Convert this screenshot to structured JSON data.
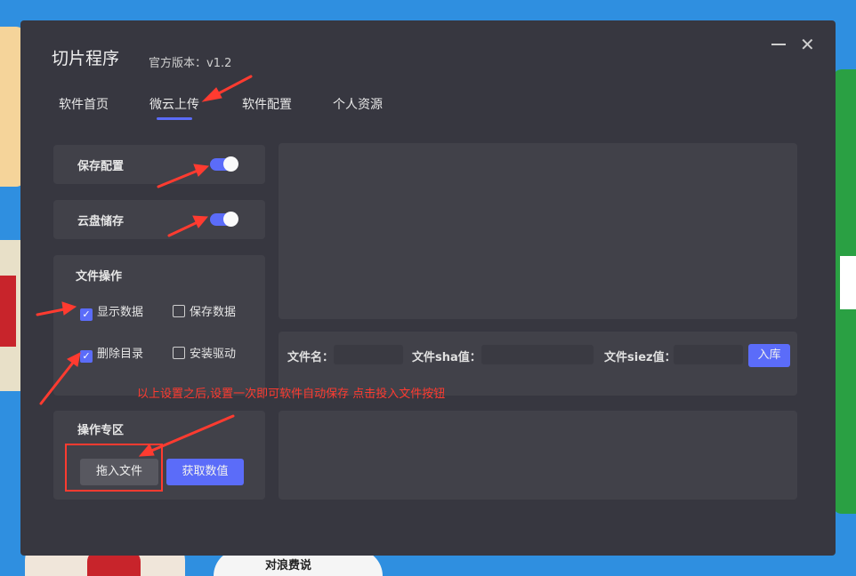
{
  "background": {
    "caption": "对浪费说"
  },
  "window": {
    "title": "切片程序",
    "version": "官方版本：v1.2",
    "close_glyph": "✕"
  },
  "tabs": [
    {
      "label": "软件首页",
      "active": false
    },
    {
      "label": "微云上传",
      "active": true
    },
    {
      "label": "软件配置",
      "active": false
    },
    {
      "label": "个人资源",
      "active": false
    }
  ],
  "save_config": {
    "label": "保存配置",
    "enabled": true
  },
  "cloud_storage": {
    "label": "云盘储存",
    "enabled": true
  },
  "file_ops": {
    "title": "文件操作",
    "show_data": {
      "label": "显示数据",
      "checked": true
    },
    "save_data": {
      "label": "保存数据",
      "checked": false
    },
    "delete_dir": {
      "label": "删除目录",
      "checked": true
    },
    "install_driver": {
      "label": "安装驱动",
      "checked": false
    }
  },
  "action_zone": {
    "title": "操作专区",
    "drag_button": "拖入文件",
    "fetch_button": "获取数值"
  },
  "file_info": {
    "name_label": "文件名：",
    "sha_label": "文件sha值：",
    "size_label": "文件siez值：",
    "name_value": "",
    "sha_value": "",
    "size_value": "",
    "submit_button": "入库"
  },
  "annotation": {
    "text": "以上设置之后,设置一次即可软件自动保存 点击投入文件按钮"
  },
  "colors": {
    "accent": "#5b6cf9",
    "window_bg": "#373740",
    "panel_bg": "#414149",
    "annotation_red": "#ff3b30"
  }
}
